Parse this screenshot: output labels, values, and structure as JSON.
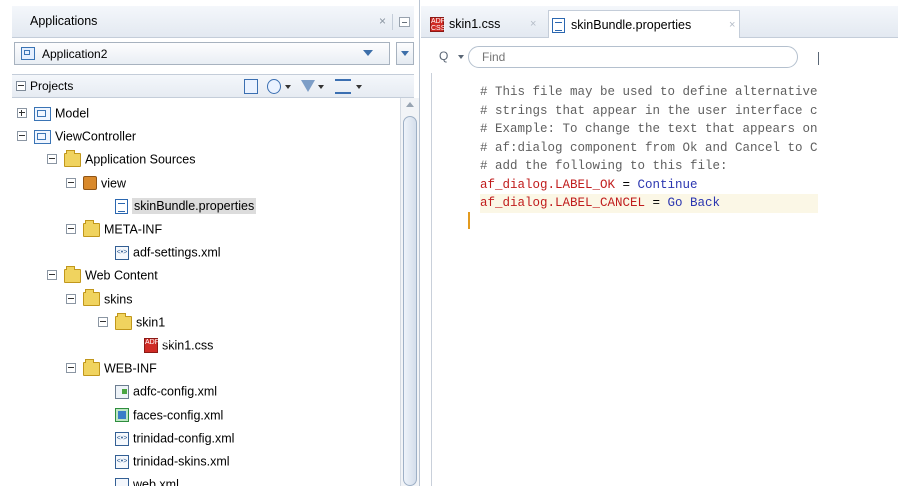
{
  "left_panel": {
    "title": "Applications",
    "close_glyph": "×",
    "application": "Application2",
    "projects_label": "Projects",
    "tree": [
      {
        "label": "Model",
        "icon": "project-icon",
        "level": 0,
        "expander": "plus"
      },
      {
        "label": "ViewController",
        "icon": "project-icon",
        "level": 0,
        "expander": "minus"
      },
      {
        "label": "Application Sources",
        "icon": "folder-icon",
        "level": 1,
        "expander": "minus"
      },
      {
        "label": "view",
        "icon": "package-icon",
        "level": 2,
        "expander": "minus"
      },
      {
        "label": "skinBundle.properties",
        "icon": "properties-file-icon",
        "level": 3,
        "expander": "none",
        "selected": true
      },
      {
        "label": "META-INF",
        "icon": "folder-icon",
        "level": 2,
        "expander": "minus"
      },
      {
        "label": "adf-settings.xml",
        "icon": "xml-file-icon",
        "level": 3,
        "expander": "none"
      },
      {
        "label": "Web Content",
        "icon": "folder-icon",
        "level": 1,
        "expander": "minus"
      },
      {
        "label": "skins",
        "icon": "folder-icon",
        "level": 2,
        "expander": "minus"
      },
      {
        "label": "skin1",
        "icon": "folder-icon",
        "level": 3,
        "expander": "minus"
      },
      {
        "label": "skin1.css",
        "icon": "css-file-icon",
        "level": 4,
        "expander": "none"
      },
      {
        "label": "WEB-INF",
        "icon": "folder-icon",
        "level": 2,
        "expander": "minus"
      },
      {
        "label": "adfc-config.xml",
        "icon": "adfc-config-icon",
        "level": 3,
        "expander": "none"
      },
      {
        "label": "faces-config.xml",
        "icon": "faces-config-icon",
        "level": 3,
        "expander": "none"
      },
      {
        "label": "trinidad-config.xml",
        "icon": "xml-file-icon",
        "level": 3,
        "expander": "none"
      },
      {
        "label": "trinidad-skins.xml",
        "icon": "xml-file-icon",
        "level": 3,
        "expander": "none"
      },
      {
        "label": "web.xml",
        "icon": "web-xml-icon",
        "level": 3,
        "expander": "none"
      }
    ]
  },
  "editor": {
    "tabs": [
      {
        "label": "skin1.css",
        "icon": "css-file-icon",
        "active": false
      },
      {
        "label": "skinBundle.properties",
        "icon": "properties-file-icon",
        "active": true
      }
    ],
    "tab_close_glyph": "×",
    "css_icon_text": "ADF CSS",
    "xml_icon_text": "<•>",
    "search_glyph": "Q",
    "find_placeholder": "Find",
    "lines": [
      {
        "type": "comment",
        "text": "# This file may be used to define alternative"
      },
      {
        "type": "comment",
        "text": "# strings that appear in the user interface c"
      },
      {
        "type": "comment",
        "text": "# Example: To change the text that appears on"
      },
      {
        "type": "comment",
        "text": "# af:dialog component from Ok and Cancel to C"
      },
      {
        "type": "comment",
        "text": "# add the following to this file:"
      },
      {
        "type": "prop",
        "key": "af_dialog.LABEL_OK",
        "sep": " = ",
        "value": "Continue"
      },
      {
        "type": "prop",
        "key": "af_dialog.LABEL_CANCEL",
        "sep": " = ",
        "value": "Go Back",
        "current": true
      }
    ]
  }
}
